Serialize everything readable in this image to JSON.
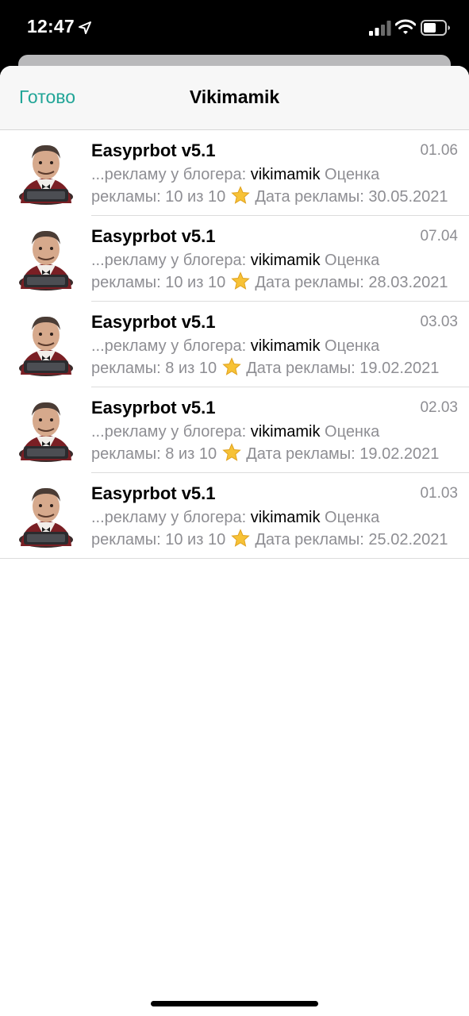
{
  "status_bar": {
    "time": "12:47"
  },
  "sheet": {
    "done_label": "Готово",
    "title": "Vikimamik"
  },
  "results": [
    {
      "sender": "Easyprbot v5.1",
      "date": "01.06",
      "prefix": "...рекламу у блогера: ",
      "highlight": "vikimamik",
      "suffix": " Оценка",
      "line2_before": "рекламы: 10 из 10",
      "line2_after": "Дата рекламы: 30.05.2021"
    },
    {
      "sender": "Easyprbot v5.1",
      "date": "07.04",
      "prefix": "...рекламу у блогера: ",
      "highlight": "vikimamik",
      "suffix": " Оценка",
      "line2_before": "рекламы: 10 из 10",
      "line2_after": "Дата рекламы: 28.03.2021"
    },
    {
      "sender": "Easyprbot v5.1",
      "date": "03.03",
      "prefix": "...рекламу у блогера: ",
      "highlight": "vikimamik",
      "suffix": " Оценка",
      "line2_before": "рекламы: 8 из 10",
      "line2_after": "Дата рекламы: 19.02.2021"
    },
    {
      "sender": "Easyprbot v5.1",
      "date": "02.03",
      "prefix": "...рекламу у блогера: ",
      "highlight": "vikimamik",
      "suffix": " Оценка",
      "line2_before": "рекламы: 8 из 10",
      "line2_after": "Дата рекламы: 19.02.2021"
    },
    {
      "sender": "Easyprbot v5.1",
      "date": "01.03",
      "prefix": "...рекламу у блогера: ",
      "highlight": "vikimamik",
      "suffix": " Оценка",
      "line2_before": "рекламы: 10 из 10",
      "line2_after": "Дата рекламы: 25.02.2021"
    }
  ],
  "icons": {
    "avatar": "butler-avatar-icon",
    "rating": "star-icon"
  },
  "colors": {
    "accent": "#21a597",
    "secondary_text": "#8e8e93",
    "star": "#f7c236"
  }
}
